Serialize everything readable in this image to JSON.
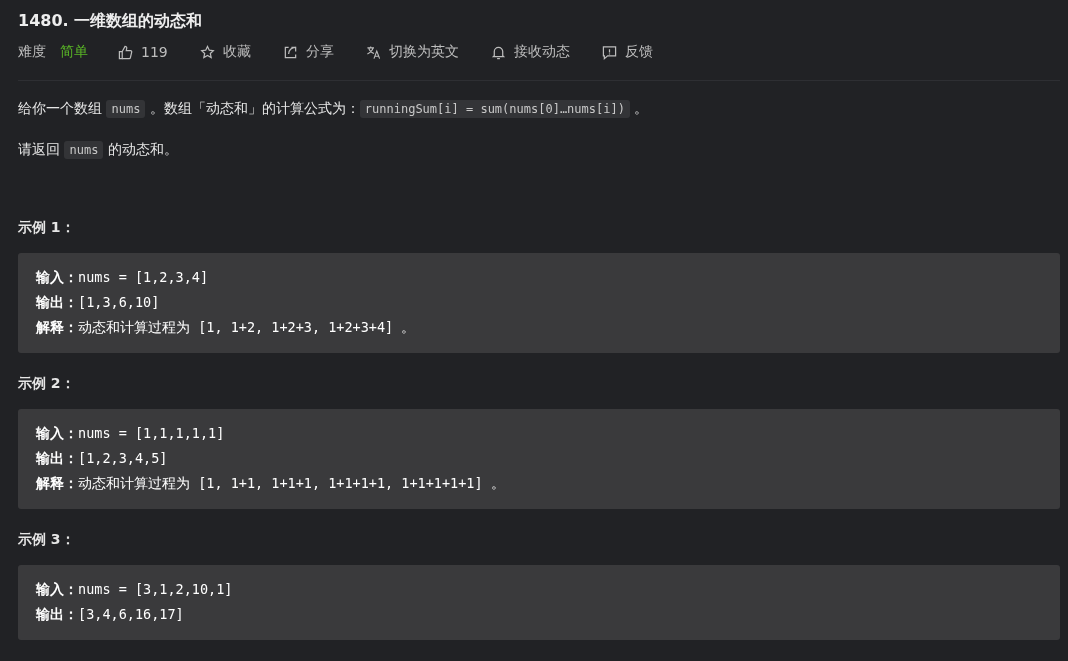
{
  "title": "1480. 一维数组的动态和",
  "toolbar": {
    "difficulty_label": "难度",
    "difficulty": "简单",
    "actions": [
      {
        "label": "119"
      },
      {
        "label": "收藏"
      },
      {
        "label": "分享"
      },
      {
        "label": "切换为英文"
      },
      {
        "label": "接收动态"
      },
      {
        "label": "反馈"
      }
    ]
  },
  "description": [
    [
      {
        "kind": "text",
        "text": "给你一个数组 "
      },
      {
        "kind": "code",
        "text": "nums"
      },
      {
        "kind": "text",
        "text": " 。数组「动态和」的计算公式为："
      },
      {
        "kind": "code",
        "text": "runningSum[i] = sum(nums[0]…nums[i])"
      },
      {
        "kind": "text",
        "text": " 。"
      }
    ],
    [
      {
        "kind": "text",
        "text": "请返回 "
      },
      {
        "kind": "code",
        "text": "nums"
      },
      {
        "kind": "text",
        "text": " 的动态和。"
      }
    ]
  ],
  "examples": [
    {
      "heading": "示例 1：",
      "lines": [
        {
          "label": "输入：",
          "value": "nums = [1,2,3,4]"
        },
        {
          "label": "输出：",
          "value": "[1,3,6,10]"
        },
        {
          "label": "解释：",
          "value": "动态和计算过程为 [1, 1+2, 1+2+3, 1+2+3+4] 。"
        }
      ]
    },
    {
      "heading": "示例 2：",
      "lines": [
        {
          "label": "输入：",
          "value": "nums = [1,1,1,1,1]"
        },
        {
          "label": "输出：",
          "value": "[1,2,3,4,5]"
        },
        {
          "label": "解释：",
          "value": "动态和计算过程为 [1, 1+1, 1+1+1, 1+1+1+1, 1+1+1+1+1] 。"
        }
      ]
    },
    {
      "heading": "示例 3：",
      "lines": [
        {
          "label": "输入：",
          "value": "nums = [3,1,2,10,1]"
        },
        {
          "label": "输出：",
          "value": "[3,4,6,16,17]"
        }
      ]
    }
  ]
}
